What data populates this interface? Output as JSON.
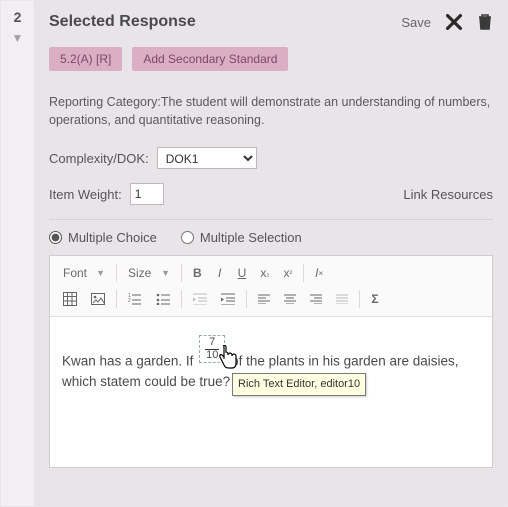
{
  "sidebar": {
    "question_number": "2"
  },
  "header": {
    "title": "Selected Response",
    "save_label": "Save"
  },
  "tags": {
    "standard": "5.2(A) [R]",
    "add_secondary": "Add Secondary Standard"
  },
  "reporting_category": {
    "label": "Reporting Category:",
    "text": "The student will demonstrate an understanding of numbers, operations, and quantitative reasoning."
  },
  "complexity": {
    "label": "Complexity/DOK:",
    "value": "DOK1"
  },
  "item_weight": {
    "label": "Item Weight:",
    "value": "1"
  },
  "link_resources": "Link Resources",
  "question_type": {
    "multiple_choice": "Multiple Choice",
    "multiple_selection": "Multiple Selection",
    "selected": "multiple_choice"
  },
  "toolbar": {
    "font_label": "Font",
    "size_label": "Size"
  },
  "editor": {
    "text_before": "Kwan has a garden. If ",
    "fraction": {
      "numerator": "7",
      "denominator": "10"
    },
    "text_mid": " of the plants in his garden are daisies, which statem",
    "text_after": " could be true?",
    "tooltip": "Rich Text Editor, editor10"
  }
}
